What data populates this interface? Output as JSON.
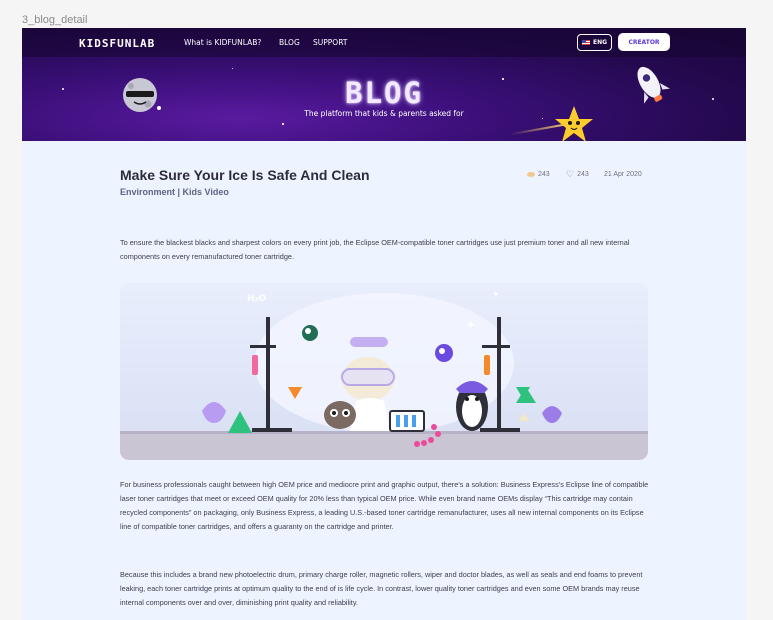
{
  "frame": {
    "label": "3_blog_detail"
  },
  "nav": {
    "logo": "KIDSFUNLAB",
    "links": [
      "What is KIDFUNLAB?",
      "BLOG",
      "SUPPORT"
    ],
    "lang": "ENG",
    "creator": "CREATOR"
  },
  "hero": {
    "title": "BLOG",
    "subtitle": "The platform that kids & parents asked for"
  },
  "article": {
    "title": "Make Sure Your Ice Is Safe And Clean",
    "category": "Environment | Kids Video",
    "views": "243",
    "likes": "243",
    "date": "21 Apr 2020",
    "intro": "To ensure the blackest blacks and sharpest colors on every print job, the Eclipse OEM-compatible toner cartridges use just premium toner and all new internal components on every remanufactured toner cartridge.",
    "body1": "For business professionals caught between high OEM price and mediocre print and graphic output, there’s a solution: Business Express’s Eclipse line of compatible laser toner cartridges that meet or exceed OEM quality for 20% less than typical OEM price. While even brand name OEMs display “This cartridge may contain recycled components” on packaging, only Business Express, a leading U.S.-based toner cartridge remanufacturer, uses all new internal components on its Eclipse line of compatible toner cartridges, and offers a guaranty on the cartridge and printer.",
    "body2": "Because this includes a brand new photoelectric drum, primary charge roller, magnetic rollers, wiper and doctor blades, as well as seals and end foams to prevent leaking, each toner cartridge prints at optimum quality to the end of is life cycle. In contrast, lower quality toner cartridges and even some OEM brands may reuse internal components over and over, diminishing print quality and reliability."
  },
  "colors": {
    "hero_bg": "#2a0a5c",
    "accent": "#5a3ad8",
    "page_bg": "#eef4ff",
    "title": "#2c2c3c"
  }
}
